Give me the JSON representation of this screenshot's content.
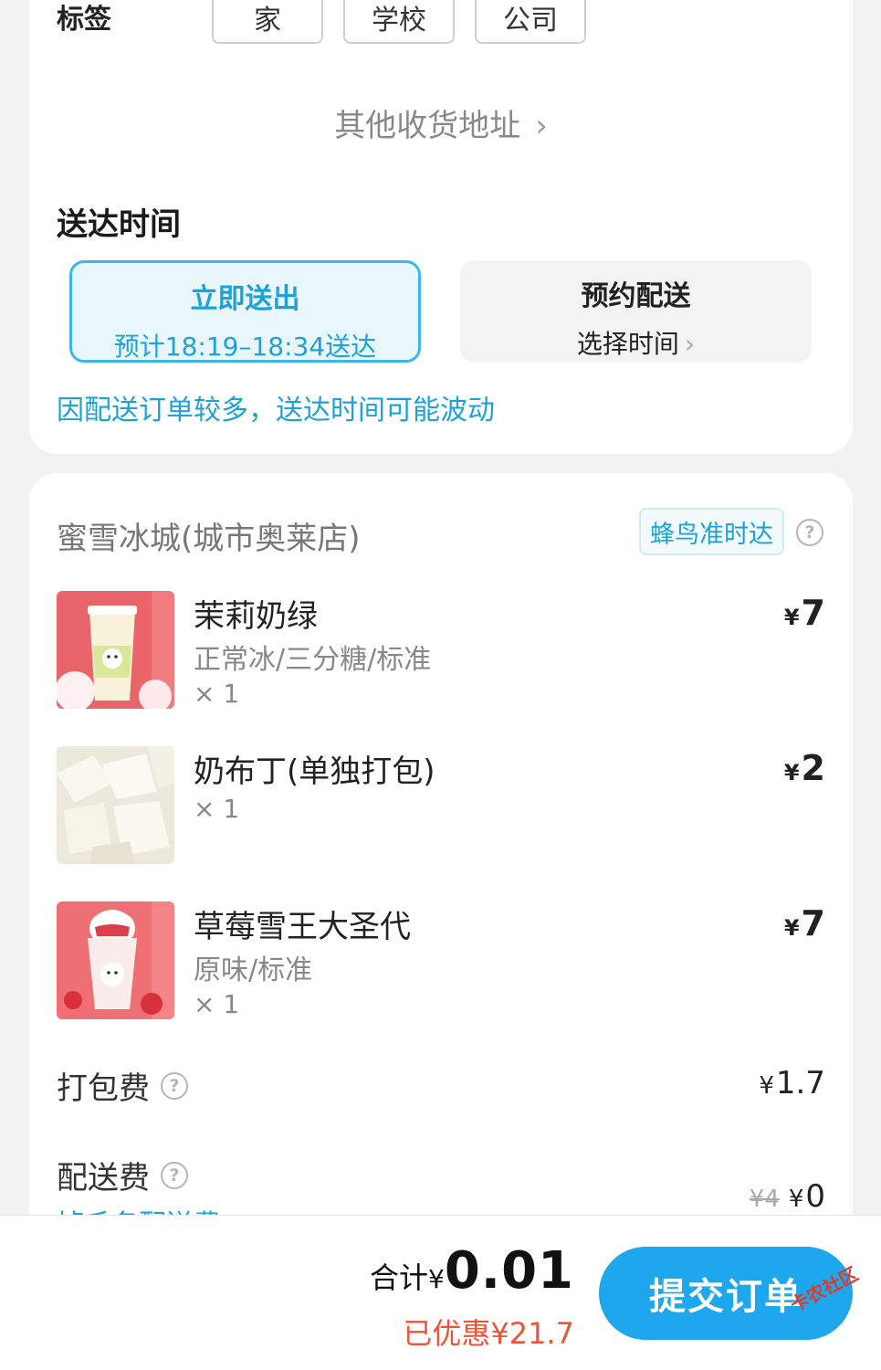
{
  "address": {
    "tag_label": "标签",
    "tags": [
      "家",
      "学校",
      "公司"
    ],
    "other_address": "其他收货地址"
  },
  "delivery_time": {
    "title": "送达时间",
    "immediate": {
      "title": "立即送出",
      "estimate": "预计18:19–18:34送达"
    },
    "scheduled": {
      "title": "预约配送",
      "subtitle": "选择时间"
    },
    "notice": "因配送订单较多，送达时间可能波动"
  },
  "store": {
    "name": "蜜雪冰城(城市奥莱店)",
    "badge": "蜂鸟准时达"
  },
  "items": [
    {
      "name": "茉莉奶绿",
      "spec": "正常冰/三分糖/标准",
      "qty": "× 1",
      "currency": "¥",
      "price": "7"
    },
    {
      "name": "奶布丁(单独打包)",
      "spec": "",
      "qty": "× 1",
      "currency": "¥",
      "price": "2"
    },
    {
      "name": "草莓雪王大圣代",
      "spec": "原味/标准",
      "qty": "× 1",
      "currency": "¥",
      "price": "7"
    }
  ],
  "fees": {
    "packing": {
      "label": "打包费",
      "currency": "¥",
      "value": "1.7"
    },
    "delivery": {
      "label": "配送费",
      "original": "¥4",
      "currency": "¥",
      "value": "0",
      "cut_text": "掉毛名配送费 >"
    }
  },
  "summary": {
    "total_label": "合计",
    "currency": "¥",
    "total": "0.01",
    "saved": "已优惠¥21.7",
    "submit": "提交订单"
  },
  "watermark": "卡农社区",
  "colors": {
    "accent": "#1fa7ee",
    "accent_text": "#1da2d8",
    "discount": "#e9553b",
    "background": "#f2f2f2"
  }
}
